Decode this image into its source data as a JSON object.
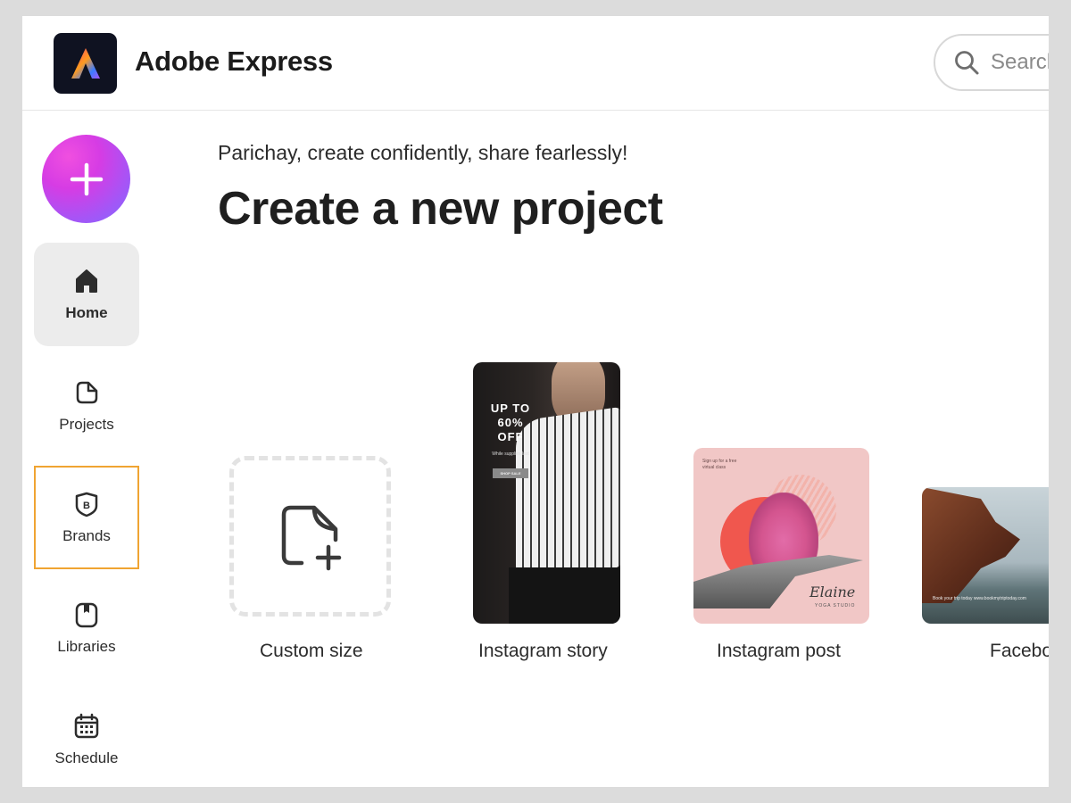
{
  "app": {
    "title": "Adobe Express",
    "brand_gradient": [
      "#ff3d71",
      "#ff9a1f",
      "#3b7bff",
      "#a855f7"
    ]
  },
  "search": {
    "placeholder": "Search"
  },
  "sidebar": {
    "create_button_icon": "plus-icon",
    "items": [
      {
        "label": "Home",
        "icon": "home-icon",
        "active": true
      },
      {
        "label": "Projects",
        "icon": "document-icon",
        "active": false
      },
      {
        "label": "Brands",
        "icon": "brand-shield-icon",
        "active": false,
        "focused": true
      },
      {
        "label": "Libraries",
        "icon": "library-icon",
        "active": false
      },
      {
        "label": "Schedule",
        "icon": "calendar-icon",
        "active": false
      }
    ]
  },
  "main": {
    "greeting": "Parichay, create confidently, share fearlessly!",
    "title": "Create a new project",
    "cards": [
      {
        "label": "Custom size",
        "icon": "new-file-icon"
      },
      {
        "label": "Instagram story",
        "thumbnail_text": {
          "headline": "UP TO\n60% OFF",
          "sub": "While supplies last",
          "button": "SHOP SALE"
        }
      },
      {
        "label": "Instagram post",
        "thumbnail_text": {
          "note": "Sign up for a free virtual class",
          "signature": "Elaine",
          "studio": "YOGA STUDIO"
        }
      },
      {
        "label": "Facebook",
        "thumbnail_text": {
          "caption": "Book your trip today www.bookmytriptoday.com"
        }
      }
    ]
  },
  "colors": {
    "accent_focus": "#f0a432",
    "create_gradient_start": "#f04fe0",
    "create_gradient_end": "#7e6cff"
  }
}
